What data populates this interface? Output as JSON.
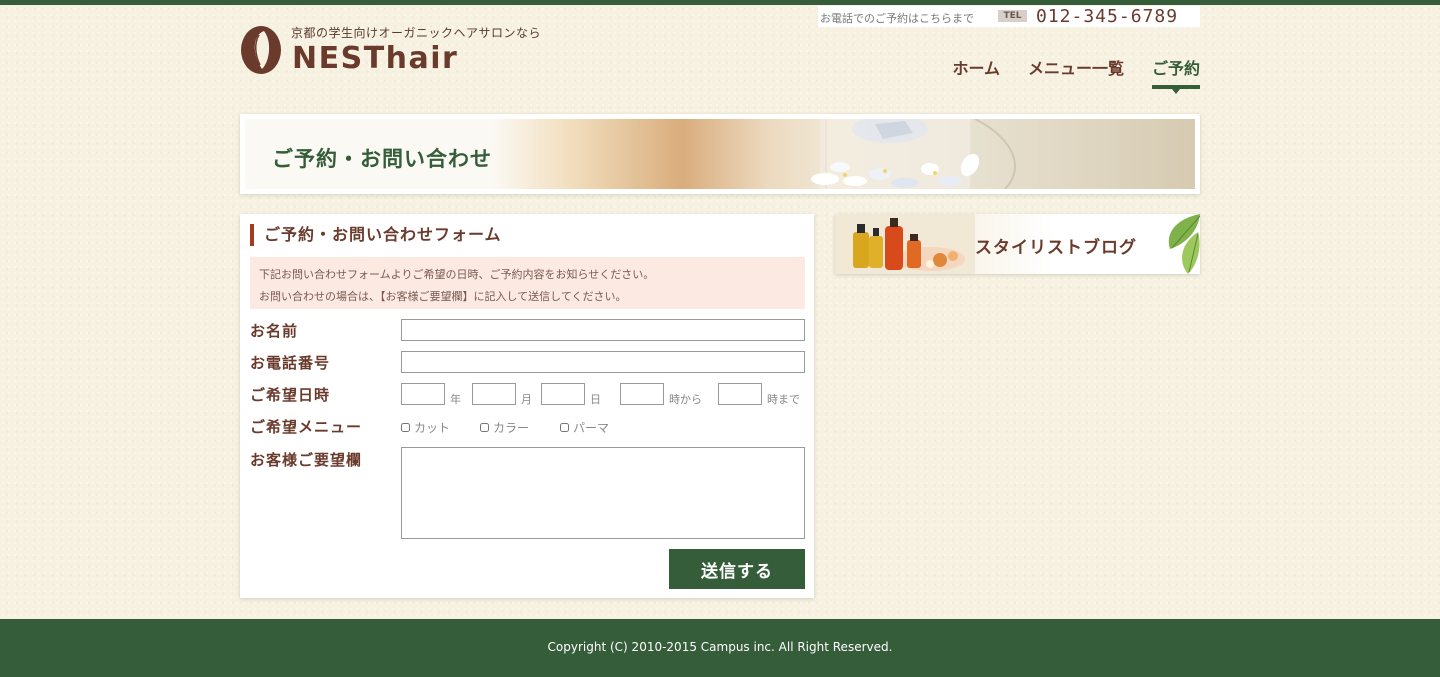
{
  "header": {
    "tagline": "京都の学生向けオーガニックヘアサロンなら",
    "logo_text": "NESThair",
    "tel_note": "お電話でのご予約はこちらまで",
    "tel_badge": "TEL",
    "tel_number": "012-345-6789"
  },
  "nav": {
    "items": [
      {
        "label": "ホーム",
        "active": false
      },
      {
        "label": "メニュー一覧",
        "active": false
      },
      {
        "label": "ご予約",
        "active": true
      }
    ]
  },
  "banner": {
    "title": "ご予約・お問い合わせ"
  },
  "form": {
    "title": "ご予約・お問い合わせフォーム",
    "notice_lines": [
      "下記お問い合わせフォームよりご希望の日時、ご予約内容をお知らせください。",
      "お問い合わせの場合は、【お客様ご要望欄】に記入して送信してください。"
    ],
    "labels": {
      "name": "お名前",
      "phone": "お電話番号",
      "datetime": "ご希望日時",
      "menu": "ご希望メニュー",
      "request": "お客様ご要望欄"
    },
    "values": {
      "name": "",
      "phone": "",
      "year": "",
      "month": "",
      "day": "",
      "time_from": "",
      "time_to": "",
      "request": ""
    },
    "units": {
      "year": "年",
      "month": "月",
      "day": "日",
      "from": "時から",
      "to": "時まで"
    },
    "menu_options": [
      {
        "label": "カット",
        "checked": false
      },
      {
        "label": "カラー",
        "checked": false
      },
      {
        "label": "パーマ",
        "checked": false
      }
    ],
    "submit_label": "送信する"
  },
  "sidebar": {
    "blog_label": "スタイリストブログ"
  },
  "footer": {
    "copyright": "Copyright (C) 2010-2015 Campus inc. All Right Reserved."
  },
  "colors": {
    "brand_green": "#355d39",
    "brand_brown": "#6a3b2c",
    "accent_red": "#a53a1f",
    "notice_bg": "#fbe9e2"
  }
}
